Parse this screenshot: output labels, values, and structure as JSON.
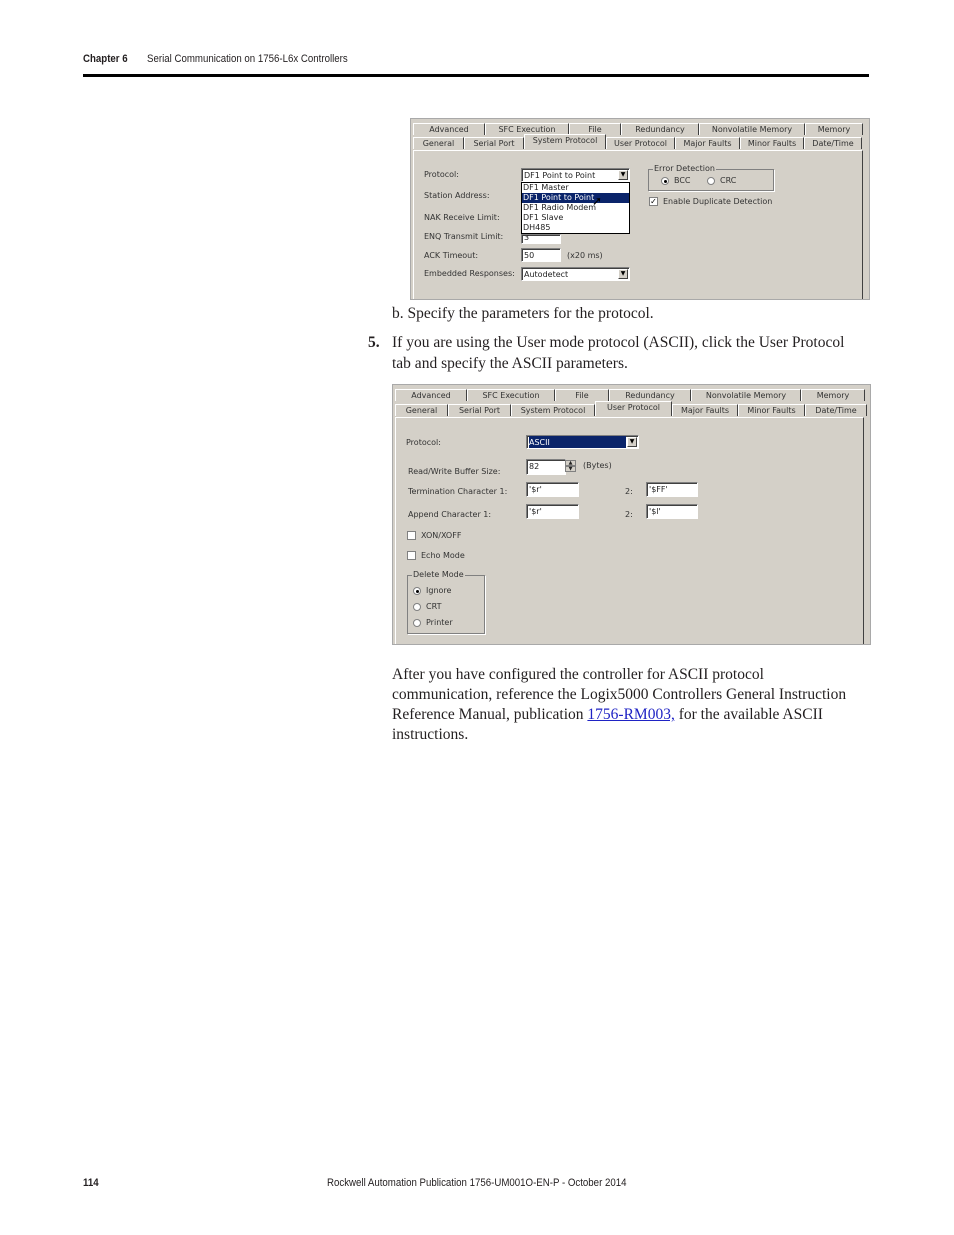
{
  "header": {
    "chapter": "Chapter 6",
    "title": "Serial Communication on 1756-L6x Controllers"
  },
  "footer": {
    "page_number": "114",
    "publication": "Rockwell Automation Publication 1756-UM001O-EN-P - October 2014"
  },
  "tabs_row_top": [
    "Advanced",
    "SFC Execution",
    "File",
    "Redundancy",
    "Nonvolatile Memory",
    "Memory"
  ],
  "tabs_row_bottom": [
    "General",
    "Serial Port",
    "System Protocol",
    "User Protocol",
    "Major Faults",
    "Minor Faults",
    "Date/Time"
  ],
  "screenshot1": {
    "active_tab": "System Protocol",
    "protocol_label": "Protocol:",
    "protocol_value": "DF1 Point to Point",
    "protocol_options": [
      "DF1 Master",
      "DF1 Point to Point",
      "DF1 Radio Modem",
      "DF1 Slave",
      "DH485"
    ],
    "highlighted_option": "DF1 Point to Point",
    "station_address_label": "Station Address:",
    "nak_label": "NAK Receive Limit:",
    "enq_label": "ENQ Transmit Limit:",
    "enq_value": "3",
    "ack_label": "ACK Timeout:",
    "ack_value": "50",
    "ack_unit": "(x20 ms)",
    "embedded_label": "Embedded Responses:",
    "embedded_value": "Autodetect",
    "error_detection": {
      "title": "Error Detection",
      "options": [
        "BCC",
        "CRC"
      ],
      "selected": "BCC"
    },
    "duplicate_detection": {
      "label": "Enable Duplicate Detection",
      "checked": true
    }
  },
  "step_b": "b.  Specify the parameters for the protocol.",
  "step5": {
    "number": "5.",
    "line1": "If you are using the User mode protocol (ASCII), click the User Protocol",
    "line2": "tab and specify the ASCII parameters."
  },
  "screenshot2": {
    "active_tab": "User Protocol",
    "protocol_label": "Protocol:",
    "protocol_value": "ASCII",
    "buffer_label": "Read/Write Buffer Size:",
    "buffer_value": "82",
    "buffer_unit": "(Bytes)",
    "term1_label": "Termination Character 1:",
    "term1_value": "'$r'",
    "term2_label": "2:",
    "term2_value": "'$FF'",
    "append1_label": "Append Character 1:",
    "append1_value": "'$r'",
    "append2_label": "2:",
    "append2_value": "'$l'",
    "xon_xoff": {
      "label": "XON/XOFF",
      "checked": false
    },
    "echo_mode": {
      "label": "Echo Mode",
      "checked": false
    },
    "delete_mode": {
      "title": "Delete Mode",
      "options": [
        "Ignore",
        "CRT",
        "Printer"
      ],
      "selected": "Ignore"
    }
  },
  "closing": {
    "line1": "After you have configured the controller for ASCII protocol",
    "line2": "communication, reference the Logix5000 Controllers General Instruction",
    "line3_before": "Reference Manual, publication ",
    "link": "1756-RM003,",
    "line3_after": " for the available ASCII",
    "line4": "instructions."
  }
}
